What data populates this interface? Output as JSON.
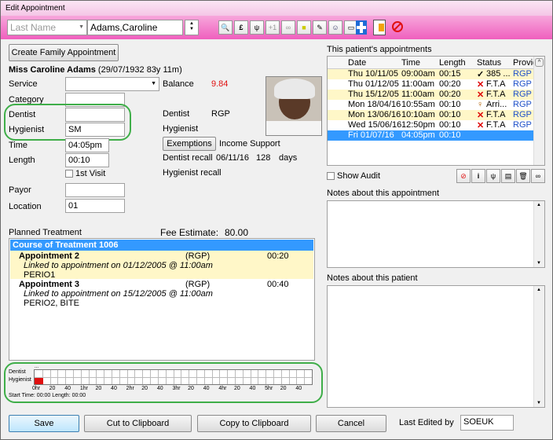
{
  "window": {
    "title": "Edit Appointment"
  },
  "toolbar": {
    "name_placeholder": "Last Name",
    "patient_name": "Adams,Caroline"
  },
  "buttons": {
    "create_family": "Create Family Appointment",
    "exemptions": "Exemptions",
    "save": "Save",
    "cut": "Cut to Clipboard",
    "copy": "Copy to Clipboard",
    "cancel": "Cancel"
  },
  "patient": {
    "heading": "Miss Caroline Adams",
    "dob": "(29/07/1932 83y 11m)"
  },
  "form": {
    "service_label": "Service",
    "balance_label": "Balance",
    "balance_value": "9.84",
    "category_label": "Category",
    "dentist_label": "Dentist",
    "dentist_value": "",
    "hygienist_label": "Hygienist",
    "hygienist_value": "SM",
    "dentist_info_label": "Dentist",
    "dentist_info_value": "RGP",
    "hygienist_info_label": "Hygienist",
    "time_label": "Time",
    "time_value": "04:05pm",
    "length_label": "Length",
    "length_value": "00:10",
    "first_visit_label": "1st Visit",
    "exemption_value": "Income Support",
    "dentist_recall_label": "Dentist recall",
    "dentist_recall_date": "06/11/16",
    "dentist_recall_days": "128",
    "days_label": "days",
    "hygienist_recall_label": "Hygienist recall",
    "payor_label": "Payor",
    "location_label": "Location",
    "location_value": "01"
  },
  "treatment": {
    "planned_label": "Planned Treatment",
    "fee_label": "Fee Estimate:",
    "fee_value": "80.00",
    "course": "Course of Treatment 1006",
    "appointments": [
      {
        "title": "Appointment 2",
        "who": "(RGP)",
        "len": "00:20",
        "linked": "Linked to appointment on 01/12/2005 @ 11:00am",
        "items": "PERIO1"
      },
      {
        "title": "Appointment 3",
        "who": "(RGP)",
        "len": "00:40",
        "linked": "Linked to appointment on 15/12/2005 @ 11:00am",
        "items": "PERIO2, BITE"
      }
    ]
  },
  "timeline": {
    "row1": "Dentist",
    "row2": "Hygienist",
    "ticks": [
      "0hr",
      "20",
      "40",
      "1hr",
      "20",
      "40",
      "2hr",
      "20",
      "40",
      "3hr",
      "20",
      "40",
      "4hr",
      "20",
      "40",
      "5hr",
      "20",
      "40"
    ],
    "start_label": "Start Time:",
    "start_value": "00:00",
    "length_label": "Length:",
    "length_value": "00:00",
    "fill_fraction": 0.03
  },
  "appointments_list": {
    "heading": "This patient's appointments",
    "columns": [
      "Date",
      "Time",
      "Length",
      "Status",
      "Provid"
    ],
    "rows": [
      {
        "date": "Thu 10/11/05",
        "time": "09:00am",
        "len": "00:15",
        "status": "385 ...",
        "prov": "RGP",
        "icon": "✓",
        "color": "#000"
      },
      {
        "date": "Thu 01/12/05",
        "time": "11:00am",
        "len": "00:20",
        "status": "F.T.A",
        "prov": "RGP",
        "icon": "✕",
        "color": "#d00"
      },
      {
        "date": "Thu 15/12/05",
        "time": "11:00am",
        "len": "00:20",
        "status": "F.T.A",
        "prov": "RGP",
        "icon": "✕",
        "color": "#d00"
      },
      {
        "date": "Mon 18/04/16",
        "time": "10:55am",
        "len": "00:10",
        "status": "Arri...",
        "prov": "RGP",
        "icon": "♀",
        "color": "#b06000"
      },
      {
        "date": "Mon 13/06/16",
        "time": "10:10am",
        "len": "00:10",
        "status": "F.T.A",
        "prov": "RGP",
        "icon": "✕",
        "color": "#d00"
      },
      {
        "date": "Wed 15/06/16",
        "time": "12:50pm",
        "len": "00:10",
        "status": "F.T.A",
        "prov": "RGP",
        "icon": "✕",
        "color": "#d00"
      },
      {
        "date": "Fri 01/07/16",
        "time": "04:05pm",
        "len": "00:10",
        "status": "",
        "prov": "",
        "icon": "",
        "color": "#000"
      }
    ]
  },
  "show_audit_label": "Show Audit",
  "notes": {
    "appt_label": "Notes about this appointment",
    "patient_label": "Notes about this patient"
  },
  "last_edited": {
    "label": "Last Edited by",
    "value": "SOEUK"
  },
  "colors": {
    "toolbar": "#ef5fbe",
    "highlight_row": "#fff7c8",
    "selected": "#3399ff",
    "green": "#3fae49",
    "balance": "#e01010"
  }
}
